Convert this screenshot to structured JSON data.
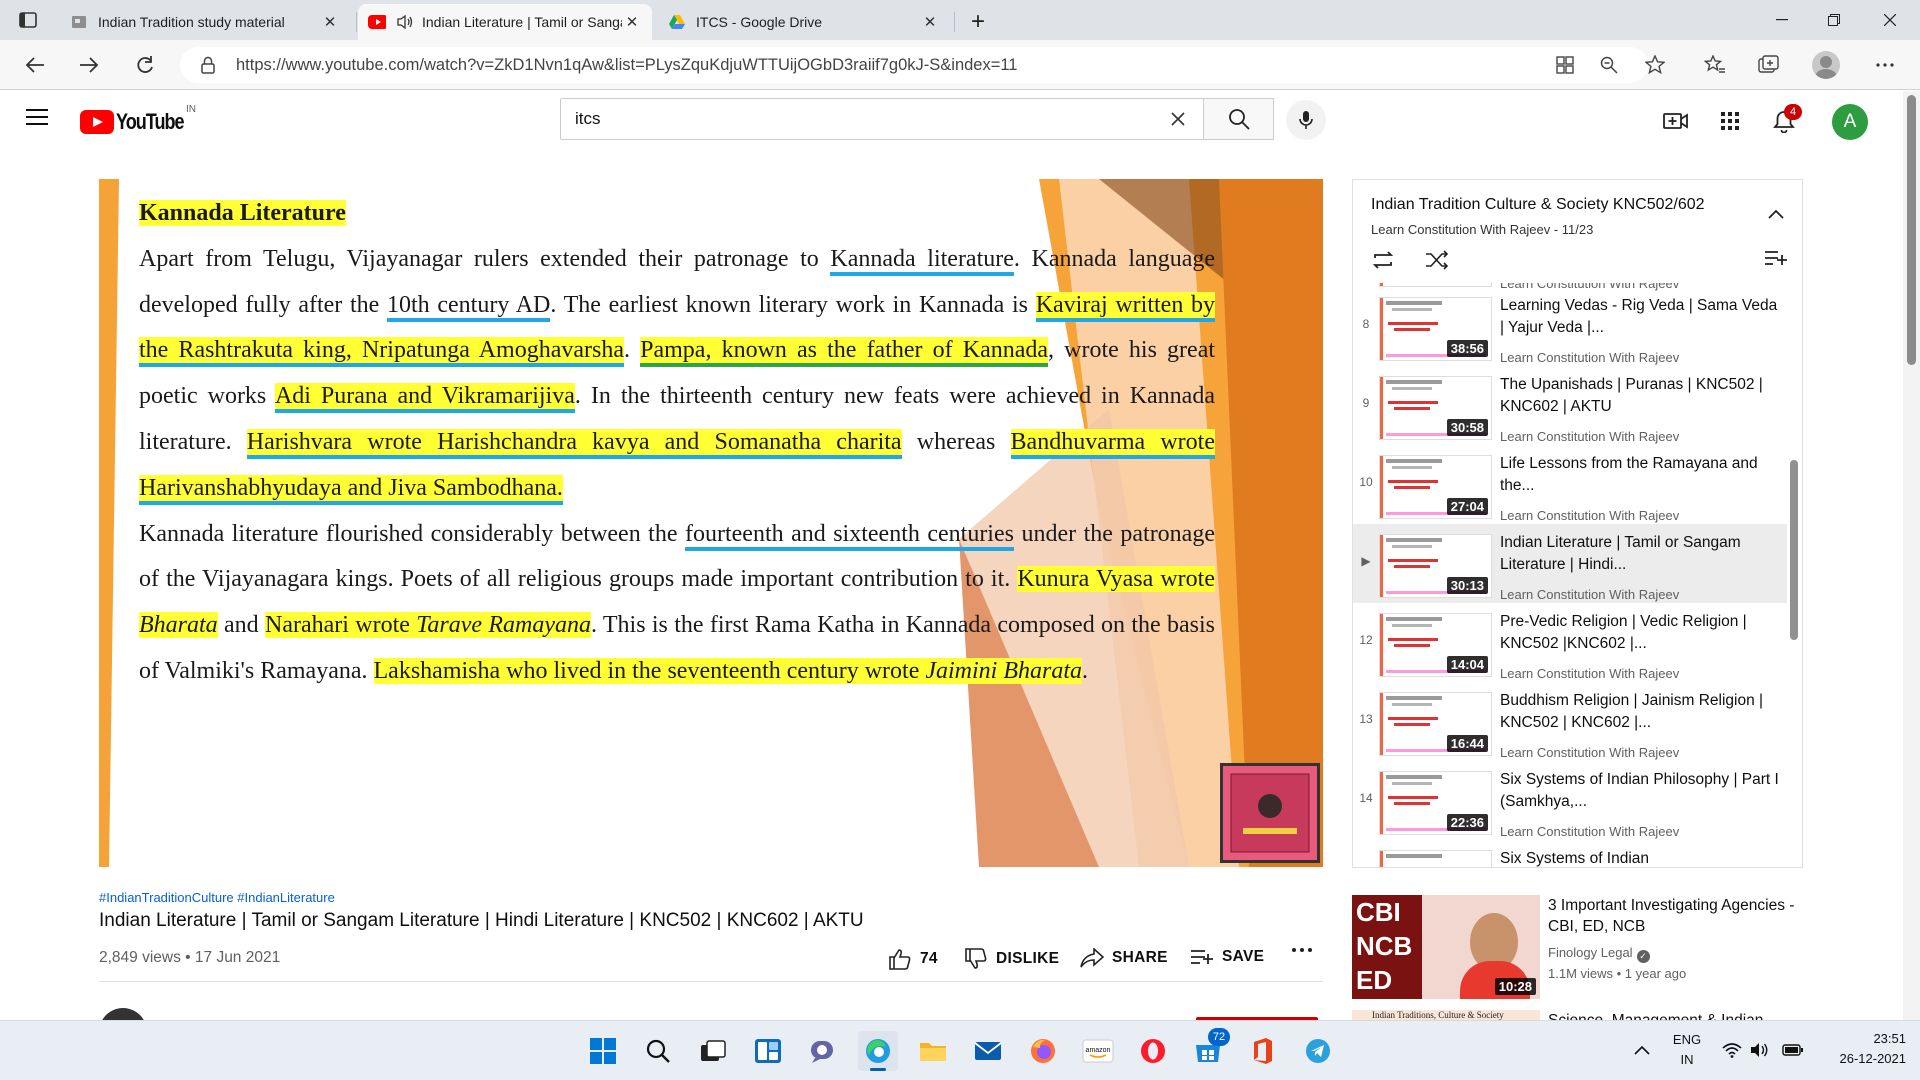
{
  "browser": {
    "tabs": [
      {
        "label": "Indian Tradition study material",
        "icon": "document-icon",
        "active": false
      },
      {
        "label": "Indian Literature | Tamil or Sangam Literature",
        "icon": "youtube-icon",
        "active": true
      },
      {
        "label": "ITCS - Google Drive",
        "icon": "google-drive-icon",
        "active": false
      }
    ],
    "url": "https://www.youtube.com/watch?v=ZkD1Nvn1qAw&list=PLysZquKdjuWTTUijOGbD3raiif7g0kJ-S&index=11"
  },
  "youtube": {
    "logo_text": "YouTube",
    "region": "IN",
    "search_value": "itcs",
    "notification_count": "4",
    "avatar_letter": "A"
  },
  "slide": {
    "heading": "Kannada Literature",
    "p1": "Apart from Telugu, Vijayanagar rulers extended their patronage to",
    "p1_ul": "Kannada literature",
    "p1b": ". Kannada language developed fully after the",
    "p1_ul2": "10th century AD",
    "p1c": ". The earliest known literary work in Kannada is",
    "p1_hl1": "Kaviraj written by the Rashtrakuta king, Nripatunga Amoghavarsha",
    "p1d": ".",
    "p1_hl2": "Pampa, known as the father of Kannada",
    "p1e": ", wrote his great poetic works",
    "p1_hl3": "Adi Purana and Vikramarijiva",
    "p1f": ". In the thirteenth century new feats were achieved in Kannada literature.",
    "p1_hl4": "Harishvara wrote Harishchandra kavya and Somanatha charita",
    "p1g": "whereas",
    "p1_hl5": "Bandhuvarma wrote Harivanshabhyudaya and Jiva Sambodhana.",
    "p2a": "Kannada literature flourished considerably between the",
    "p2_ul": "fourteenth and sixteenth centuries",
    "p2b": "under the patronage of the Vijayanagara kings. Poets of all religious groups made important contribution to it.",
    "p2_hl1": "Kunura Vyasa wrote",
    "p2_hl1_i": "Bharata",
    "p2c": "and",
    "p2_hl2": "Narahari wrote",
    "p2_hl2_i": "Tarave Ramayana",
    "p2d": ". This is the first Rama Katha in Kannada composed on the basis of Valmiki's Ramayana.",
    "p2_hl3": "Lakshamisha who lived in the seventeenth century wrote",
    "p2_hl3_i": "Jaimini Bharata",
    "p2e": "."
  },
  "video": {
    "hashtags": "#IndianTraditionCulture #IndianLiterature",
    "title": "Indian Literature | Tamil or Sangam Literature | Hindi Literature | KNC502 | KNC602 | AKTU",
    "meta": "2,849 views • 17 Jun 2021",
    "likes": "74",
    "dislike_label": "DISLIKE",
    "share_label": "SHARE",
    "save_label": "SAVE"
  },
  "playlist": {
    "title": "Indian Tradition Culture & Society KNC502/602",
    "subtitle": "Learn Constitution With Rajeev - 11/23",
    "partial_top": "Learn Constitution With Rajeev",
    "items": [
      {
        "index": "8",
        "title": "Learning Vedas - Rig Veda | Sama Veda | Yajur Veda |...",
        "channel": "Learn Constitution With Rajeev",
        "duration": "38:56"
      },
      {
        "index": "9",
        "title": "The Upanishads | Puranas | KNC502 | KNC602 | AKTU",
        "channel": "Learn Constitution With Rajeev",
        "duration": "30:58"
      },
      {
        "index": "10",
        "title": "Life Lessons from the Ramayana and the...",
        "channel": "Learn Constitution With Rajeev",
        "duration": "27:04"
      },
      {
        "index": "▶",
        "title": "Indian Literature | Tamil or Sangam Literature | Hindi...",
        "channel": "Learn Constitution With Rajeev",
        "duration": "30:13"
      },
      {
        "index": "12",
        "title": "Pre-Vedic Religion | Vedic Religion | KNC502 |KNC602 |...",
        "channel": "Learn Constitution With Rajeev",
        "duration": "14:04"
      },
      {
        "index": "13",
        "title": "Buddhism Religion | Jainism Religion | KNC502 | KNC602 |...",
        "channel": "Learn Constitution With Rajeev",
        "duration": "16:44"
      },
      {
        "index": "14",
        "title": "Six Systems of Indian Philosophy | Part I (Samkhya,...",
        "channel": "Learn Constitution With Rajeev",
        "duration": "22:36"
      }
    ],
    "partial_bottom": "Six Systems of Indian"
  },
  "recommended": [
    {
      "title": "3 Important Investigating Agencies - CBI, ED, NCB",
      "channel": "Finology Legal",
      "meta": "1.1M views • 1 year ago",
      "duration": "10:28",
      "thumb_text": [
        "CBI",
        "NCB",
        "ED"
      ]
    },
    {
      "title": "Science, Management & Indian",
      "thumb_text": "Indian Traditions, Culture & Society"
    }
  ],
  "taskbar": {
    "store_badge": "72",
    "lang_top": "ENG",
    "lang_bottom": "IN",
    "time": "23:51",
    "date": "26-12-2021"
  }
}
